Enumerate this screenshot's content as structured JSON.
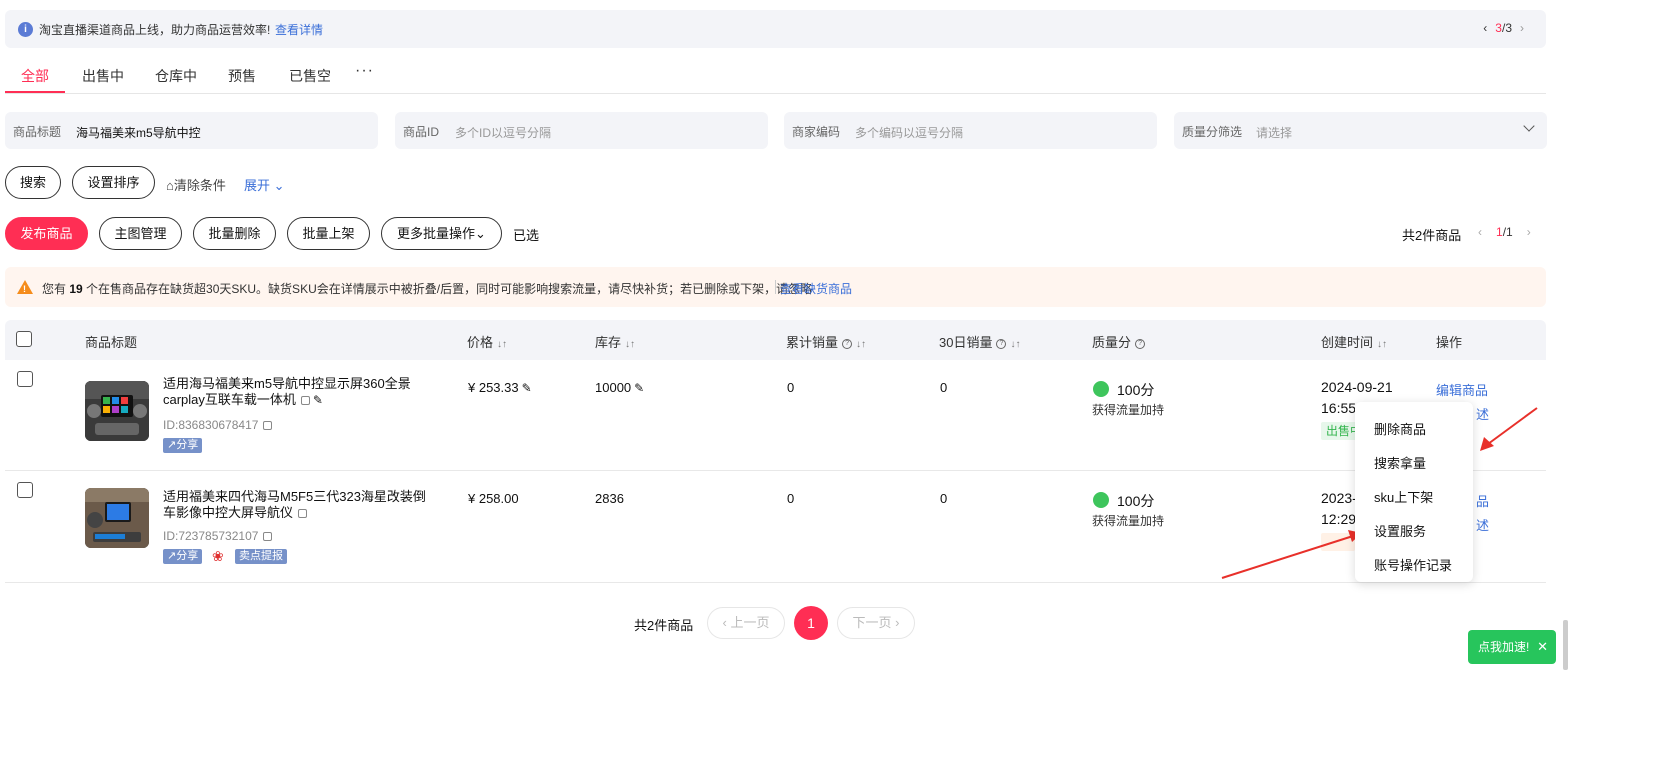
{
  "notice": {
    "text": "淘宝直播渠道商品上线，助力商品运营效率!",
    "link": "查看详情",
    "page_current": "3",
    "page_total": "/3"
  },
  "tabs": [
    {
      "label": "全部"
    },
    {
      "label": "出售中"
    },
    {
      "label": "仓库中"
    },
    {
      "label": "预售"
    },
    {
      "label": "已售空"
    }
  ],
  "tab_more": "···",
  "filters": {
    "title_label": "商品标题",
    "title_value": "海马福美来m5导航中控",
    "id_label": "商品ID",
    "id_placeholder": "多个ID以逗号分隔",
    "code_label": "商家编码",
    "code_placeholder": "多个编码以逗号分隔",
    "quality_label": "质量分筛选",
    "quality_placeholder": "请选择"
  },
  "actions": {
    "search": "搜索",
    "set_sort": "设置排序",
    "clear": "清除条件",
    "expand": "展开"
  },
  "batch": {
    "publish": "发布商品",
    "main_image": "主图管理",
    "batch_delete": "批量删除",
    "batch_list": "批量上架",
    "more_batch": "更多批量操作",
    "selected": "已选",
    "total": "共2件商品",
    "page_current": "1",
    "page_total": "/1"
  },
  "warning": {
    "prefix": "您有 ",
    "count": "19",
    "text": " 个在售商品存在缺货超30天SKU。缺货SKU会在详情展示中被折叠/后置，同时可能影响搜索流量，请尽快补货；若已删除或下架，请忽略",
    "link": "查看缺货商品"
  },
  "table": {
    "headers": {
      "title": "商品标题",
      "price": "价格",
      "stock": "库存",
      "total_sales": "累计销量",
      "sales_30d": "30日销量",
      "quality": "质量分",
      "created": "创建时间",
      "ops": "操作"
    },
    "rows": [
      {
        "title": "适用海马福美来m5导航中控显示屏360全景carplay互联车载一体机",
        "id": "ID:836830678417",
        "tags": [
          "分享"
        ],
        "price": "¥ 253.33",
        "stock": "10000",
        "total_sales": "0",
        "sales_30d": "0",
        "quality": "100分",
        "quality_sub": "获得流量加持",
        "created_date": "2024-09-21",
        "created_time": "16:55",
        "status": "出售中",
        "op1": "编辑商品",
        "op2": "述"
      },
      {
        "title": "适用福美来四代海马M5F5三代323海星改装倒车影像中控大屏导航仪",
        "id": "ID:723785732107",
        "tags": [
          "分享",
          "卖点提报"
        ],
        "price": "¥ 258.00",
        "stock": "2836",
        "total_sales": "0",
        "sales_30d": "0",
        "quality": "100分",
        "quality_sub": "获得流量加持",
        "created_date": "2023-",
        "created_time": "12:29",
        "op1": "品",
        "op2": "述"
      }
    ]
  },
  "menu": [
    "删除商品",
    "搜索拿量",
    "sku上下架",
    "设置服务",
    "账号操作记录"
  ],
  "pagination": {
    "total": "共2件商品",
    "prev": "上一页",
    "current": "1",
    "next": "下一页"
  },
  "float_btn": {
    "label": "点我加速!",
    "close": "✕"
  },
  "colors": {
    "accent": "#ff2e54",
    "link": "#3b6fd8",
    "success": "#27c55c",
    "warning": "#f58c1b"
  }
}
